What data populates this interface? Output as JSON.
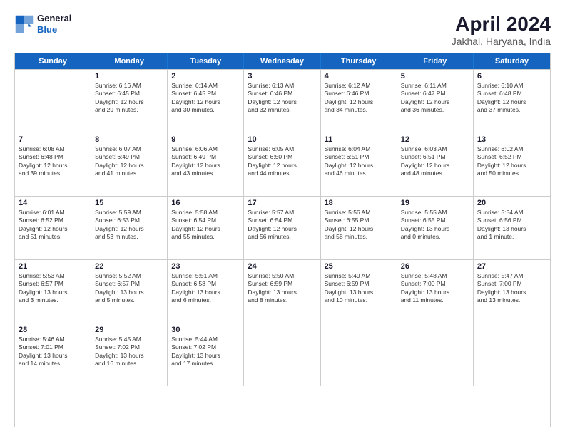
{
  "logo": {
    "line1": "General",
    "line2": "Blue"
  },
  "title": "April 2024",
  "subtitle": "Jakhal, Haryana, India",
  "header": {
    "days": [
      "Sunday",
      "Monday",
      "Tuesday",
      "Wednesday",
      "Thursday",
      "Friday",
      "Saturday"
    ]
  },
  "weeks": [
    [
      {
        "day": "",
        "sunrise": "",
        "sunset": "",
        "daylight": ""
      },
      {
        "day": "1",
        "sunrise": "Sunrise: 6:16 AM",
        "sunset": "Sunset: 6:45 PM",
        "daylight": "Daylight: 12 hours and 29 minutes."
      },
      {
        "day": "2",
        "sunrise": "Sunrise: 6:14 AM",
        "sunset": "Sunset: 6:45 PM",
        "daylight": "Daylight: 12 hours and 30 minutes."
      },
      {
        "day": "3",
        "sunrise": "Sunrise: 6:13 AM",
        "sunset": "Sunset: 6:46 PM",
        "daylight": "Daylight: 12 hours and 32 minutes."
      },
      {
        "day": "4",
        "sunrise": "Sunrise: 6:12 AM",
        "sunset": "Sunset: 6:46 PM",
        "daylight": "Daylight: 12 hours and 34 minutes."
      },
      {
        "day": "5",
        "sunrise": "Sunrise: 6:11 AM",
        "sunset": "Sunset: 6:47 PM",
        "daylight": "Daylight: 12 hours and 36 minutes."
      },
      {
        "day": "6",
        "sunrise": "Sunrise: 6:10 AM",
        "sunset": "Sunset: 6:48 PM",
        "daylight": "Daylight: 12 hours and 37 minutes."
      }
    ],
    [
      {
        "day": "7",
        "sunrise": "Sunrise: 6:08 AM",
        "sunset": "Sunset: 6:48 PM",
        "daylight": "Daylight: 12 hours and 39 minutes."
      },
      {
        "day": "8",
        "sunrise": "Sunrise: 6:07 AM",
        "sunset": "Sunset: 6:49 PM",
        "daylight": "Daylight: 12 hours and 41 minutes."
      },
      {
        "day": "9",
        "sunrise": "Sunrise: 6:06 AM",
        "sunset": "Sunset: 6:49 PM",
        "daylight": "Daylight: 12 hours and 43 minutes."
      },
      {
        "day": "10",
        "sunrise": "Sunrise: 6:05 AM",
        "sunset": "Sunset: 6:50 PM",
        "daylight": "Daylight: 12 hours and 44 minutes."
      },
      {
        "day": "11",
        "sunrise": "Sunrise: 6:04 AM",
        "sunset": "Sunset: 6:51 PM",
        "daylight": "Daylight: 12 hours and 46 minutes."
      },
      {
        "day": "12",
        "sunrise": "Sunrise: 6:03 AM",
        "sunset": "Sunset: 6:51 PM",
        "daylight": "Daylight: 12 hours and 48 minutes."
      },
      {
        "day": "13",
        "sunrise": "Sunrise: 6:02 AM",
        "sunset": "Sunset: 6:52 PM",
        "daylight": "Daylight: 12 hours and 50 minutes."
      }
    ],
    [
      {
        "day": "14",
        "sunrise": "Sunrise: 6:01 AM",
        "sunset": "Sunset: 6:52 PM",
        "daylight": "Daylight: 12 hours and 51 minutes."
      },
      {
        "day": "15",
        "sunrise": "Sunrise: 5:59 AM",
        "sunset": "Sunset: 6:53 PM",
        "daylight": "Daylight: 12 hours and 53 minutes."
      },
      {
        "day": "16",
        "sunrise": "Sunrise: 5:58 AM",
        "sunset": "Sunset: 6:54 PM",
        "daylight": "Daylight: 12 hours and 55 minutes."
      },
      {
        "day": "17",
        "sunrise": "Sunrise: 5:57 AM",
        "sunset": "Sunset: 6:54 PM",
        "daylight": "Daylight: 12 hours and 56 minutes."
      },
      {
        "day": "18",
        "sunrise": "Sunrise: 5:56 AM",
        "sunset": "Sunset: 6:55 PM",
        "daylight": "Daylight: 12 hours and 58 minutes."
      },
      {
        "day": "19",
        "sunrise": "Sunrise: 5:55 AM",
        "sunset": "Sunset: 6:55 PM",
        "daylight": "Daylight: 13 hours and 0 minutes."
      },
      {
        "day": "20",
        "sunrise": "Sunrise: 5:54 AM",
        "sunset": "Sunset: 6:56 PM",
        "daylight": "Daylight: 13 hours and 1 minute."
      }
    ],
    [
      {
        "day": "21",
        "sunrise": "Sunrise: 5:53 AM",
        "sunset": "Sunset: 6:57 PM",
        "daylight": "Daylight: 13 hours and 3 minutes."
      },
      {
        "day": "22",
        "sunrise": "Sunrise: 5:52 AM",
        "sunset": "Sunset: 6:57 PM",
        "daylight": "Daylight: 13 hours and 5 minutes."
      },
      {
        "day": "23",
        "sunrise": "Sunrise: 5:51 AM",
        "sunset": "Sunset: 6:58 PM",
        "daylight": "Daylight: 13 hours and 6 minutes."
      },
      {
        "day": "24",
        "sunrise": "Sunrise: 5:50 AM",
        "sunset": "Sunset: 6:59 PM",
        "daylight": "Daylight: 13 hours and 8 minutes."
      },
      {
        "day": "25",
        "sunrise": "Sunrise: 5:49 AM",
        "sunset": "Sunset: 6:59 PM",
        "daylight": "Daylight: 13 hours and 10 minutes."
      },
      {
        "day": "26",
        "sunrise": "Sunrise: 5:48 AM",
        "sunset": "Sunset: 7:00 PM",
        "daylight": "Daylight: 13 hours and 11 minutes."
      },
      {
        "day": "27",
        "sunrise": "Sunrise: 5:47 AM",
        "sunset": "Sunset: 7:00 PM",
        "daylight": "Daylight: 13 hours and 13 minutes."
      }
    ],
    [
      {
        "day": "28",
        "sunrise": "Sunrise: 5:46 AM",
        "sunset": "Sunset: 7:01 PM",
        "daylight": "Daylight: 13 hours and 14 minutes."
      },
      {
        "day": "29",
        "sunrise": "Sunrise: 5:45 AM",
        "sunset": "Sunset: 7:02 PM",
        "daylight": "Daylight: 13 hours and 16 minutes."
      },
      {
        "day": "30",
        "sunrise": "Sunrise: 5:44 AM",
        "sunset": "Sunset: 7:02 PM",
        "daylight": "Daylight: 13 hours and 17 minutes."
      },
      {
        "day": "",
        "sunrise": "",
        "sunset": "",
        "daylight": ""
      },
      {
        "day": "",
        "sunrise": "",
        "sunset": "",
        "daylight": ""
      },
      {
        "day": "",
        "sunrise": "",
        "sunset": "",
        "daylight": ""
      },
      {
        "day": "",
        "sunrise": "",
        "sunset": "",
        "daylight": ""
      }
    ]
  ]
}
